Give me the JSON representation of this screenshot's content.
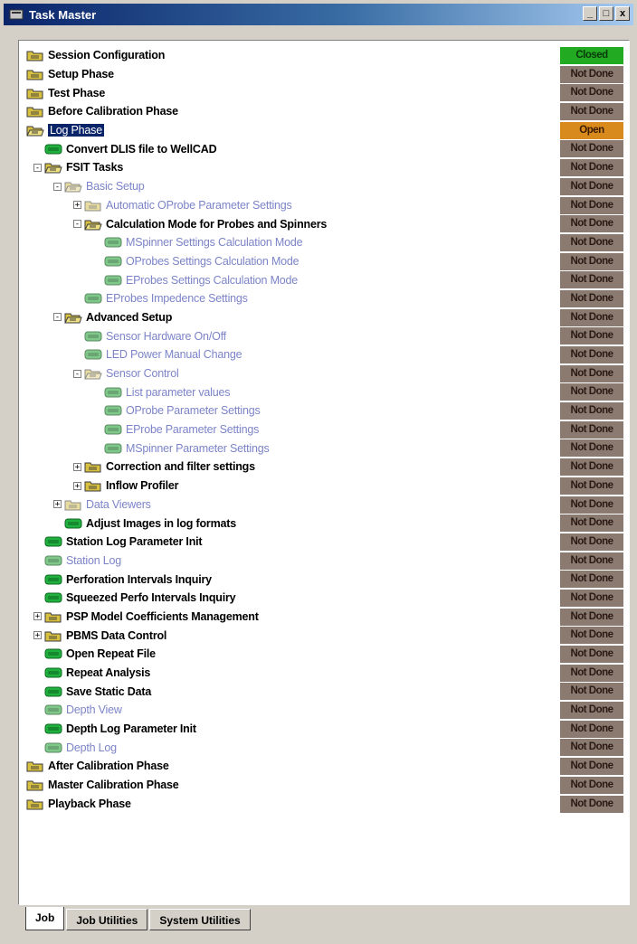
{
  "window": {
    "title": "Task Master",
    "buttons": [
      "_",
      "□",
      "x"
    ]
  },
  "colors": {
    "done": "#22aa22",
    "open": "#d88a1c",
    "not_done": "#8a7a70"
  },
  "tasks": [
    {
      "label": "Session Configuration",
      "level": 0,
      "icon": "folder",
      "expander": "",
      "style": "bold",
      "status": "Closed",
      "state": "done"
    },
    {
      "label": "Setup Phase",
      "level": 0,
      "icon": "folder",
      "expander": "",
      "style": "bold",
      "status": "Not Done",
      "state": "not_done"
    },
    {
      "label": "Test Phase",
      "level": 0,
      "icon": "folder",
      "expander": "",
      "style": "bold",
      "status": "Not Done",
      "state": "not_done"
    },
    {
      "label": "Before Calibration Phase",
      "level": 0,
      "icon": "folder",
      "expander": "",
      "style": "bold",
      "status": "Not Done",
      "state": "not_done"
    },
    {
      "label": "Log Phase",
      "level": 0,
      "icon": "folder-open",
      "expander": "",
      "style": "sel",
      "status": "Open",
      "state": "open"
    },
    {
      "label": "Convert DLIS file to WellCAD",
      "level": 1,
      "icon": "task",
      "expander": "",
      "style": "bold",
      "status": "Not Done",
      "state": "not_done"
    },
    {
      "label": "FSIT Tasks",
      "level": 1,
      "icon": "folder-open",
      "expander": "-",
      "style": "bold",
      "status": "Not Done",
      "state": "not_done"
    },
    {
      "label": "Basic Setup",
      "level": 2,
      "icon": "folder-open-dim",
      "expander": "-",
      "style": "dim",
      "status": "Not Done",
      "state": "not_done"
    },
    {
      "label": "Automatic OProbe Parameter Settings",
      "level": 3,
      "icon": "folder-dim",
      "expander": "+",
      "style": "dim",
      "status": "Not Done",
      "state": "not_done"
    },
    {
      "label": "Calculation Mode for Probes and Spinners",
      "level": 3,
      "icon": "folder-open",
      "expander": "-",
      "style": "bold",
      "status": "Not Done",
      "state": "not_done"
    },
    {
      "label": "MSpinner Settings Calculation Mode",
      "level": 4,
      "icon": "task-dim",
      "expander": "",
      "style": "dim",
      "status": "Not Done",
      "state": "not_done"
    },
    {
      "label": "OProbes Settings Calculation Mode",
      "level": 4,
      "icon": "task-dim",
      "expander": "",
      "style": "dim",
      "status": "Not Done",
      "state": "not_done"
    },
    {
      "label": "EProbes Settings Calculation Mode",
      "level": 4,
      "icon": "task-dim",
      "expander": "",
      "style": "dim",
      "status": "Not Done",
      "state": "not_done"
    },
    {
      "label": "EProbes Impedence Settings",
      "level": 3,
      "icon": "task-dim",
      "expander": "",
      "style": "dim",
      "status": "Not Done",
      "state": "not_done"
    },
    {
      "label": "Advanced Setup",
      "level": 2,
      "icon": "folder-open",
      "expander": "-",
      "style": "bold",
      "status": "Not Done",
      "state": "not_done"
    },
    {
      "label": "Sensor Hardware On/Off",
      "level": 3,
      "icon": "task-dim",
      "expander": "",
      "style": "dim",
      "status": "Not Done",
      "state": "not_done"
    },
    {
      "label": "LED Power Manual Change",
      "level": 3,
      "icon": "task-dim",
      "expander": "",
      "style": "dim",
      "status": "Not Done",
      "state": "not_done"
    },
    {
      "label": "Sensor Control",
      "level": 3,
      "icon": "folder-open-dim",
      "expander": "-",
      "style": "dim",
      "status": "Not Done",
      "state": "not_done"
    },
    {
      "label": "List parameter values",
      "level": 4,
      "icon": "task-dim",
      "expander": "",
      "style": "dim",
      "status": "Not Done",
      "state": "not_done"
    },
    {
      "label": "OProbe Parameter Settings",
      "level": 4,
      "icon": "task-dim",
      "expander": "",
      "style": "dim",
      "status": "Not Done",
      "state": "not_done"
    },
    {
      "label": "EProbe Parameter Settings",
      "level": 4,
      "icon": "task-dim",
      "expander": "",
      "style": "dim",
      "status": "Not Done",
      "state": "not_done"
    },
    {
      "label": "MSpinner Parameter Settings",
      "level": 4,
      "icon": "task-dim",
      "expander": "",
      "style": "dim",
      "status": "Not Done",
      "state": "not_done"
    },
    {
      "label": "Correction and filter settings",
      "level": 3,
      "icon": "folder",
      "expander": "+",
      "style": "bold",
      "status": "Not Done",
      "state": "not_done"
    },
    {
      "label": "Inflow Profiler",
      "level": 3,
      "icon": "folder",
      "expander": "+",
      "style": "bold",
      "status": "Not Done",
      "state": "not_done"
    },
    {
      "label": "Data Viewers",
      "level": 2,
      "icon": "folder-dim",
      "expander": "+",
      "style": "dim",
      "status": "Not Done",
      "state": "not_done"
    },
    {
      "label": "Adjust Images in log formats",
      "level": 2,
      "icon": "task",
      "expander": "",
      "style": "bold",
      "status": "Not Done",
      "state": "not_done"
    },
    {
      "label": "Station Log Parameter Init",
      "level": 1,
      "icon": "task",
      "expander": "",
      "style": "bold",
      "status": "Not Done",
      "state": "not_done"
    },
    {
      "label": "Station Log",
      "level": 1,
      "icon": "task-dim",
      "expander": "",
      "style": "dim",
      "status": "Not Done",
      "state": "not_done"
    },
    {
      "label": "Perforation Intervals Inquiry",
      "level": 1,
      "icon": "task",
      "expander": "",
      "style": "bold",
      "status": "Not Done",
      "state": "not_done"
    },
    {
      "label": "Squeezed Perfo Intervals Inquiry",
      "level": 1,
      "icon": "task",
      "expander": "",
      "style": "bold",
      "status": "Not Done",
      "state": "not_done"
    },
    {
      "label": "PSP Model Coefficients Management",
      "level": 1,
      "icon": "folder",
      "expander": "+",
      "style": "bold",
      "status": "Not Done",
      "state": "not_done"
    },
    {
      "label": "PBMS Data Control",
      "level": 1,
      "icon": "folder",
      "expander": "+",
      "style": "bold",
      "status": "Not Done",
      "state": "not_done"
    },
    {
      "label": "Open Repeat File",
      "level": 1,
      "icon": "task",
      "expander": "",
      "style": "bold",
      "status": "Not Done",
      "state": "not_done"
    },
    {
      "label": "Repeat Analysis",
      "level": 1,
      "icon": "task",
      "expander": "",
      "style": "bold",
      "status": "Not Done",
      "state": "not_done"
    },
    {
      "label": "Save Static Data",
      "level": 1,
      "icon": "task",
      "expander": "",
      "style": "bold",
      "status": "Not Done",
      "state": "not_done"
    },
    {
      "label": "Depth View",
      "level": 1,
      "icon": "task-dim",
      "expander": "",
      "style": "dim",
      "status": "Not Done",
      "state": "not_done"
    },
    {
      "label": "Depth Log Parameter Init",
      "level": 1,
      "icon": "task",
      "expander": "",
      "style": "bold",
      "status": "Not Done",
      "state": "not_done"
    },
    {
      "label": "Depth Log",
      "level": 1,
      "icon": "task-dim",
      "expander": "",
      "style": "dim",
      "status": "Not Done",
      "state": "not_done"
    },
    {
      "label": "After Calibration Phase",
      "level": 0,
      "icon": "folder",
      "expander": "",
      "style": "bold",
      "status": "Not Done",
      "state": "not_done"
    },
    {
      "label": "Master Calibration Phase",
      "level": 0,
      "icon": "folder",
      "expander": "",
      "style": "bold",
      "status": "Not Done",
      "state": "not_done"
    },
    {
      "label": "Playback Phase",
      "level": 0,
      "icon": "folder",
      "expander": "",
      "style": "bold",
      "status": "Not Done",
      "state": "not_done"
    }
  ],
  "tabs": [
    {
      "label": "Job",
      "active": true
    },
    {
      "label": "Job Utilities",
      "active": false
    },
    {
      "label": "System Utilities",
      "active": false
    }
  ]
}
